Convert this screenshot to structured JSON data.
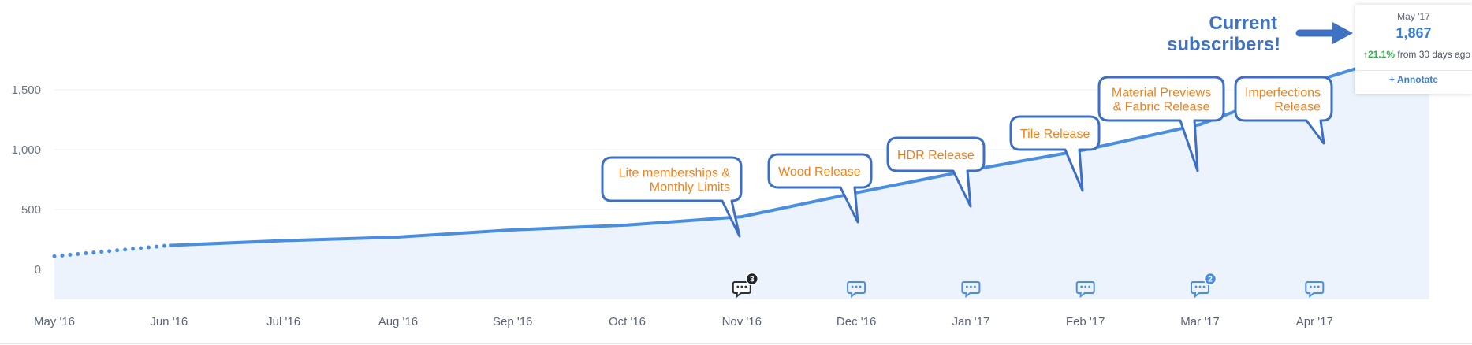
{
  "chart_data": {
    "type": "area",
    "x_categories": [
      "May '16",
      "Jun '16",
      "Jul '16",
      "Aug '16",
      "Sep '16",
      "Oct '16",
      "Nov '16",
      "Dec '16",
      "Jan '17",
      "Feb '17",
      "Mar '17",
      "Apr '17",
      "May '17"
    ],
    "x_tick_labels": [
      "May '16",
      "Jun '16",
      "Jul '16",
      "Aug '16",
      "Sep '16",
      "Oct '16",
      "Nov '16",
      "Dec '16",
      "Jan '17",
      "Feb '17",
      "Mar '17",
      "Apr '17"
    ],
    "series": [
      {
        "values": [
          110,
          200,
          240,
          270,
          330,
          370,
          440,
          640,
          830,
          1000,
          1210,
          1570,
          1867
        ],
        "dotted_until_index": 1,
        "color": "#4a8ee0",
        "fill_color": "#edf3fc"
      }
    ],
    "yticks": [
      0,
      500,
      1000,
      1500
    ],
    "ytick_labels": [
      "0",
      "500",
      "1,000",
      "1,500"
    ],
    "ylim": [
      -250,
      2250
    ],
    "grid": true,
    "annotations": [
      {
        "lines": [
          "Lite memberships &",
          "Monthly Limits"
        ],
        "align": "right",
        "x_index": 6
      },
      {
        "lines": [
          "Wood Release"
        ],
        "align": "left",
        "x_index": 7
      },
      {
        "lines": [
          "HDR Release"
        ],
        "align": "left",
        "x_index": 8
      },
      {
        "lines": [
          "Tile Release"
        ],
        "align": "left",
        "x_index": 9
      },
      {
        "lines": [
          "Material Previews",
          "& Fabric Release"
        ],
        "align": "center",
        "x_index": 10
      },
      {
        "lines": [
          "Imperfections",
          "Release"
        ],
        "align": "right",
        "x_index": 11.3
      }
    ],
    "note_markers": [
      {
        "x_index": 6,
        "count": "3",
        "dark": true
      },
      {
        "x_index": 7,
        "count": "",
        "dark": false
      },
      {
        "x_index": 8,
        "count": "",
        "dark": false
      },
      {
        "x_index": 9,
        "count": "",
        "dark": false
      },
      {
        "x_index": 10,
        "count": "2",
        "dark": false
      },
      {
        "x_index": 11,
        "count": "",
        "dark": false
      }
    ]
  },
  "tooltip": {
    "date": "May '17",
    "value": "1,867",
    "change_arrow": "↑",
    "change_pct": "21.1%",
    "change_text": "from 30 days ago",
    "annotate_label": "+ Annotate"
  },
  "callout": {
    "line1": "Current",
    "line2": "subscribers!",
    "color": "#3f72c2"
  },
  "colors": {
    "line": "#4a8ee0",
    "area": "#edf3fc",
    "annotation_border": "#3d6fc4",
    "annotation_text": "#f0801a",
    "positive": "#2eb34a"
  }
}
